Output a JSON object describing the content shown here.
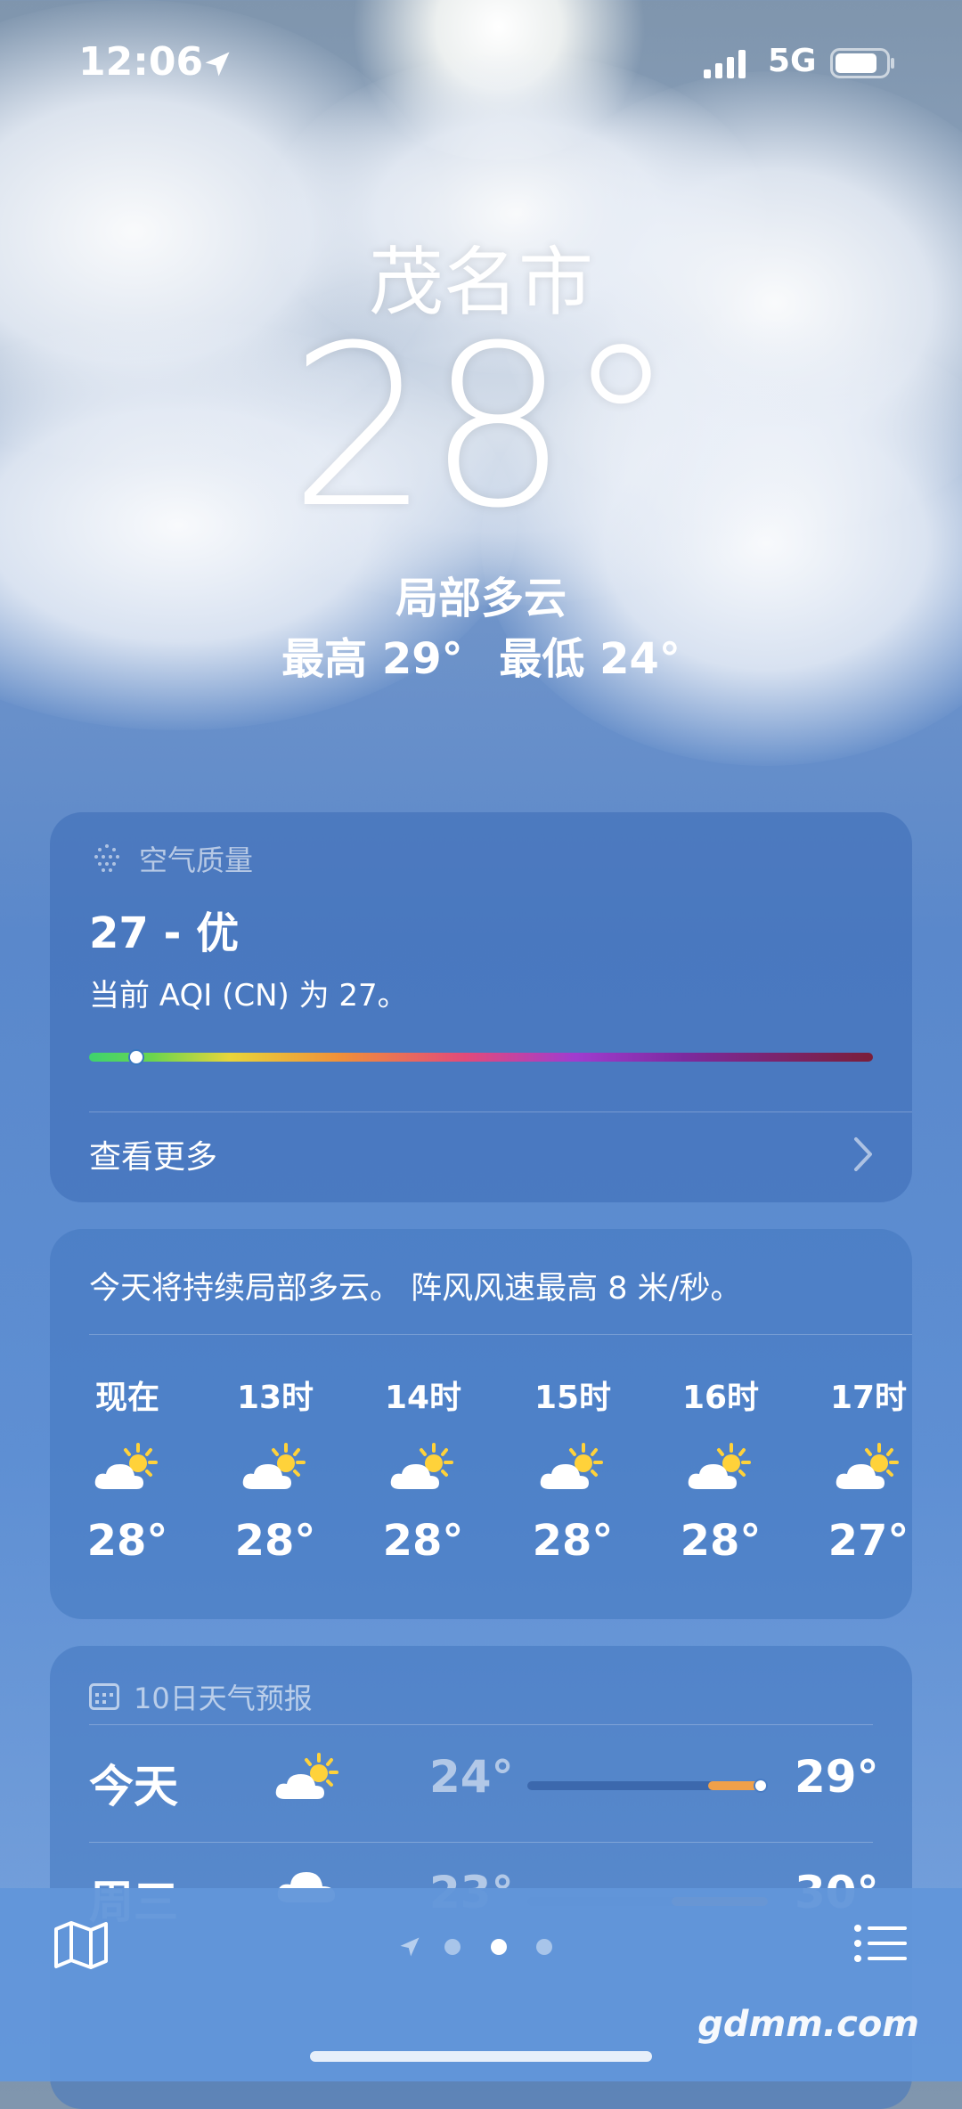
{
  "status_bar": {
    "time": "12:06",
    "network": "5G"
  },
  "header": {
    "city": "茂名市",
    "temperature": "28°",
    "condition": "局部多云",
    "high": "最高 29°",
    "low": "最低 24°"
  },
  "aqi": {
    "title": "空气质量",
    "value": "27 - 优",
    "description": "当前 AQI (CN) 为 27。",
    "level_fraction": 0.06,
    "more": "查看更多"
  },
  "hourly": {
    "summary": "今天将持续局部多云。 阵风风速最高 8 米/秒。",
    "hours": [
      {
        "label": "现在",
        "temp": "28°",
        "icon": "partly-sunny-icon"
      },
      {
        "label": "13时",
        "temp": "28°",
        "icon": "partly-sunny-icon"
      },
      {
        "label": "14时",
        "temp": "28°",
        "icon": "partly-sunny-icon"
      },
      {
        "label": "15时",
        "temp": "28°",
        "icon": "partly-sunny-icon"
      },
      {
        "label": "16时",
        "temp": "28°",
        "icon": "partly-sunny-icon"
      },
      {
        "label": "17时",
        "temp": "27°",
        "icon": "partly-sunny-icon"
      }
    ]
  },
  "daily": {
    "title": "10日天气预报",
    "days": [
      {
        "label": "今天",
        "low": "24°",
        "high": "29°",
        "icon": "partly-sunny-icon",
        "range_start": 0.75,
        "range_end": 0.97,
        "current": 0.97
      },
      {
        "label": "周三",
        "low": "23°",
        "high": "30°",
        "icon": "cloud-icon",
        "range_start": 0.6,
        "range_end": 1.0
      }
    ]
  },
  "bottom_bar": {
    "pages": 3,
    "active_page": 1
  },
  "watermark": "gdmm.com",
  "colors": {
    "aqi_good": "#3ed36e",
    "range_fill": "#f0a04a"
  }
}
